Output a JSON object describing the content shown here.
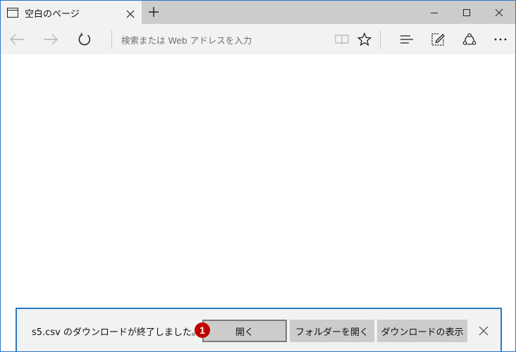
{
  "tab": {
    "title": "空白のページ",
    "icon": "page-icon",
    "close_icon": "close-icon"
  },
  "new_tab_icon": "plus-icon",
  "window_controls": [
    "minimize-icon",
    "maximize-icon",
    "close-icon"
  ],
  "navbar": {
    "back_icon": "arrow-left-icon",
    "forward_icon": "arrow-right-icon",
    "refresh_icon": "refresh-icon",
    "address_placeholder": "検索または Web アドレスを入力",
    "reading_view_icon": "book-icon",
    "favorite_icon": "star-icon",
    "hub_icon": "hub-icon",
    "note_icon": "pen-note-icon",
    "share_icon": "share-icon",
    "more_icon": "more-icon"
  },
  "download_bar": {
    "message": "s5.csv のダウンロードが終了しました。",
    "badge": "1",
    "open_label": "開く",
    "open_folder_label": "フォルダーを開く",
    "view_downloads_label": "ダウンロードの表示",
    "close_icon": "close-icon"
  },
  "colors": {
    "accent": "#2b78c5",
    "badge": "#c00000",
    "tabstrip": "#cccccc",
    "toolbar": "#f2f2f2"
  }
}
